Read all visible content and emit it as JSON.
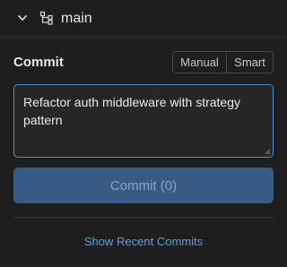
{
  "branch": {
    "name": "main",
    "chevron_icon": "chevron-down-icon",
    "branch_icon": "branch-icon"
  },
  "commit": {
    "label": "Commit",
    "modes": [
      "Manual",
      "Smart"
    ],
    "message": "Refactor auth middleware with strategy pattern",
    "button_label": "Commit (0)"
  },
  "footer": {
    "show_recent_label": "Show Recent Commits"
  },
  "colors": {
    "background": "#1e1e1e",
    "accent": "#4f8fd6",
    "button_bg": "#385a85",
    "link": "#5aa0e8"
  }
}
